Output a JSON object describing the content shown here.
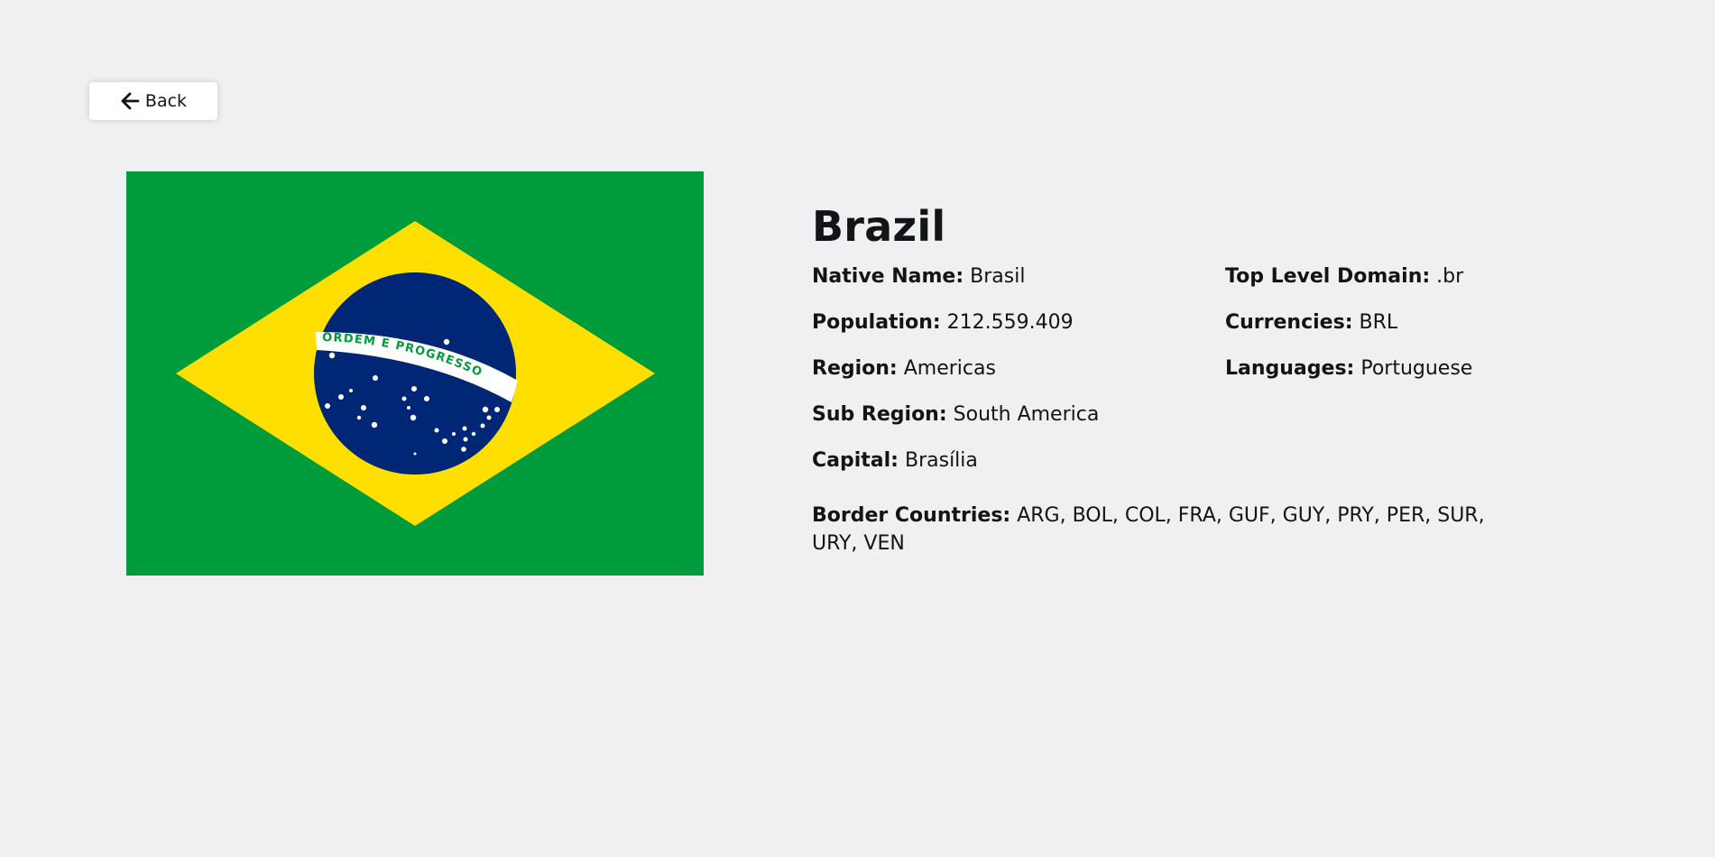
{
  "back": {
    "label": "Back",
    "icon": "arrow-left-icon"
  },
  "flag": {
    "motto": "ORDEM E PROGRESSO",
    "colors": {
      "green": "#009b3a",
      "yellow": "#fedf00",
      "blue": "#002776",
      "white": "#ffffff"
    }
  },
  "country": {
    "name": "Brazil",
    "native_name_label": "Native Name:",
    "native_name": "Brasil",
    "population_label": "Population:",
    "population": "212.559.409",
    "region_label": "Region:",
    "region": "Americas",
    "sub_region_label": "Sub Region:",
    "sub_region": "South America",
    "capital_label": "Capital:",
    "capital": "Brasília",
    "tld_label": "Top Level Domain:",
    "tld": ".br",
    "currencies_label": "Currencies:",
    "currencies": "BRL",
    "languages_label": "Languages:",
    "languages": "Portuguese",
    "border_label": "Border Countries:",
    "borders": "ARG, BOL, COL, FRA, GUF, GUY, PRY, PER, SUR, URY, VEN"
  },
  "colors": {
    "background": "#f0eff1",
    "text": "#111517",
    "button_bg": "#ffffff"
  }
}
